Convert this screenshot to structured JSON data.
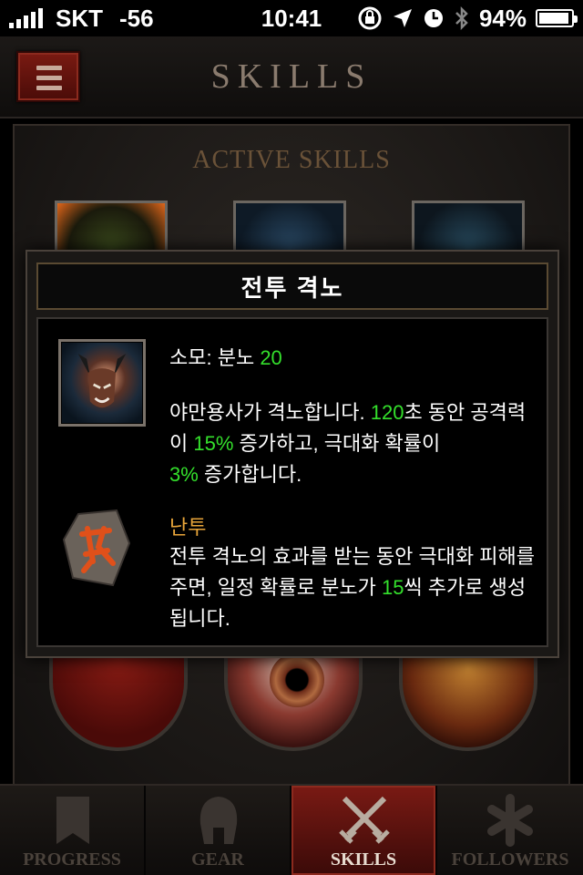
{
  "status_bar": {
    "carrier": "SKT",
    "signal": "-56",
    "time": "10:41",
    "battery_percent": "94%",
    "battery_level": 0.94,
    "icons": [
      "orientation-lock-icon",
      "location-icon",
      "alarm-icon",
      "bluetooth-icon",
      "battery-icon"
    ]
  },
  "header": {
    "title": "SKILLS",
    "menu_icon": "hamburger-icon"
  },
  "section": {
    "title": "ACTIVE SKILLS"
  },
  "tooltip": {
    "title": "전투 격노",
    "cost_prefix": "소모: 분노 ",
    "cost_value": "20",
    "description": {
      "part1": "야만용사가 격노합니다. ",
      "duration": "120",
      "part2": "초 동안 공격력이 ",
      "damage": "15%",
      "part3": " 증가하고, 극대화 확률이 ",
      "crit": "3%",
      "part4": " 증가합니다."
    },
    "rune": {
      "name": "난투",
      "part1": "전투 격노의 효과를 받는 동안 극대화 피해를 주면, 일정 확률로 분노가 ",
      "value": "15",
      "part2": "씩 추가로 생성됩니다."
    }
  },
  "colors": {
    "highlight_green": "#34e02c",
    "rune_orange": "#e8a53a",
    "accent_red": "#7a1a14"
  },
  "tabs": [
    {
      "label": "PROGRESS",
      "icon": "banner-icon",
      "active": false
    },
    {
      "label": "GEAR",
      "icon": "helmet-icon",
      "active": false
    },
    {
      "label": "SKILLS",
      "icon": "crossed-swords-icon",
      "active": true
    },
    {
      "label": "FOLLOWERS",
      "icon": "asterisk-icon",
      "active": false
    }
  ]
}
